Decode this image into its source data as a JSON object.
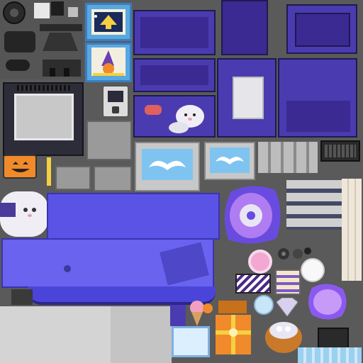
{
  "atlas": {
    "colors": {
      "background": "#5a5a5a",
      "purple_panel": "#4b3bb0",
      "purple_dark": "#3a2a92",
      "blue_fabric": "#5b52e6",
      "blue_fabric_light": "#6a63f0",
      "screen_blue": "#7fc4f0",
      "pumpkin_orange": "#f08a2a",
      "ghost_white": "#f0eef4",
      "lilac": "#b07cf2",
      "light_grey": "#c8c8c8",
      "dark_grey": "#3a3a3a"
    },
    "regions": [
      "speaker-parts",
      "arcade-poster-rocket",
      "arcade-poster-pumpkin",
      "purple-cabinet-panels",
      "grey-tv-console",
      "handheld-device",
      "ghost-plush",
      "monitor-left",
      "monitor-right",
      "keyboard",
      "pumpkin-sticker",
      "ghost-pillow",
      "blue-couch-fabric",
      "purple-rug",
      "donut",
      "lilac-disc",
      "orange-gift-box",
      "ice-cream",
      "blue-tray",
      "basket-of-eggs",
      "wood-planks"
    ]
  }
}
